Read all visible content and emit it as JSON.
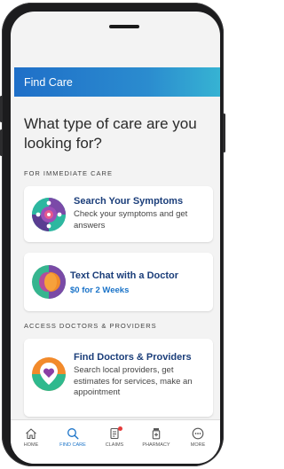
{
  "header": {
    "title": "Find Care"
  },
  "main": {
    "question": "What type of care are you looking for?",
    "sections": [
      {
        "label": "FOR IMMEDIATE CARE",
        "cards": [
          {
            "title": "Search Your Symptoms",
            "description": "Check your symptoms and get answers",
            "icon": "symptoms-icon"
          },
          {
            "title": "Text Chat with a Doctor",
            "price": "$0 for 2 Weeks",
            "icon": "chat-doctor-icon"
          }
        ]
      },
      {
        "label": "ACCESS DOCTORS & PROVIDERS",
        "cards": [
          {
            "title": "Find Doctors & Providers",
            "description": "Search local providers, get estimates for services, make an appointment",
            "icon": "heart-location-icon"
          }
        ]
      }
    ]
  },
  "tabbar": {
    "items": [
      {
        "label": "HOME",
        "icon": "home-icon"
      },
      {
        "label": "FIND CARE",
        "icon": "search-icon",
        "active": true
      },
      {
        "label": "CLAIMS",
        "icon": "claims-icon"
      },
      {
        "label": "PHARMACY",
        "icon": "pill-bottle-icon"
      },
      {
        "label": "MORE",
        "icon": "more-icon"
      }
    ]
  },
  "colors": {
    "accent": "#1a73c8",
    "title": "#1b3e7a",
    "header_start": "#1f6fc8",
    "header_end": "#36b3d3"
  }
}
